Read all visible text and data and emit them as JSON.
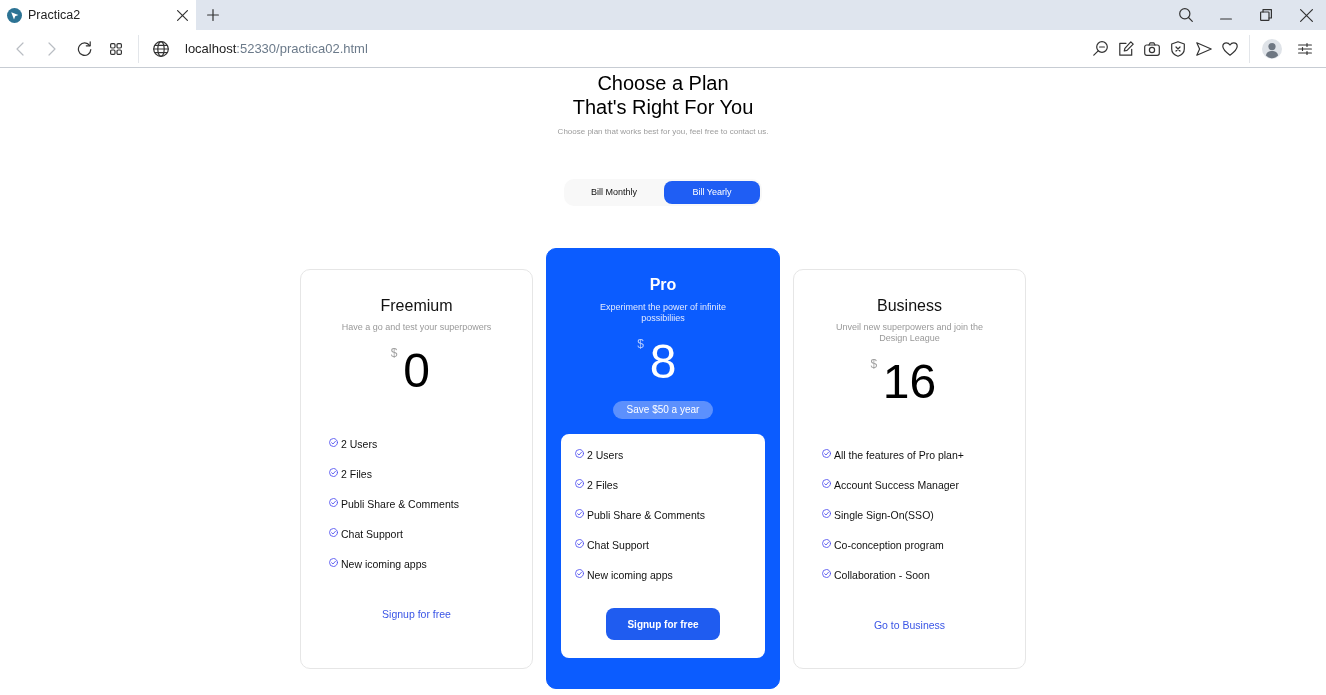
{
  "browser": {
    "tab": {
      "title": "Practica2"
    },
    "back": {
      "disabled": true
    },
    "forward": {
      "disabled": true
    },
    "address": {
      "host": "localhost",
      "path": ":52330/practica02.html"
    }
  },
  "header": {
    "title": "Choose a Plan\nThat's Right For You",
    "subtitle": "Choose plan that works best for you, feel free to contact us."
  },
  "billing_toggle": [
    {
      "label": "Bill Monthly",
      "selected": false
    },
    {
      "label": "Bill Yearly",
      "selected": true
    }
  ],
  "plans": [
    {
      "name": "Freemium",
      "featured": false,
      "description": "Have a go and test your superpowers",
      "currency": "$",
      "price": "0",
      "features": [
        "2 Users",
        "2 Files",
        "Publi Share & Comments",
        "Chat Support",
        "New icoming apps"
      ],
      "action": {
        "kind": "link",
        "label": "Signup for free"
      }
    },
    {
      "name": "Pro",
      "featured": true,
      "description": "Experiment the power of infinite possibiliies",
      "currency": "$",
      "price": "8",
      "badge": "Save $50 a year",
      "features": [
        "2 Users",
        "2 Files",
        "Publi Share & Comments",
        "Chat Support",
        "New icoming apps"
      ],
      "action": {
        "kind": "button",
        "label": "Signup for free"
      }
    },
    {
      "name": "Business",
      "featured": false,
      "description": "Unveil new superpowers and join the Design League",
      "currency": "$",
      "price": "16",
      "features": [
        "All the features of Pro plan+",
        "Account Success Manager",
        "Single Sign-On(SSO)",
        "Co-conception program",
        "Collaboration - Soon"
      ],
      "action": {
        "kind": "link",
        "label": "Go to Business"
      }
    }
  ]
}
